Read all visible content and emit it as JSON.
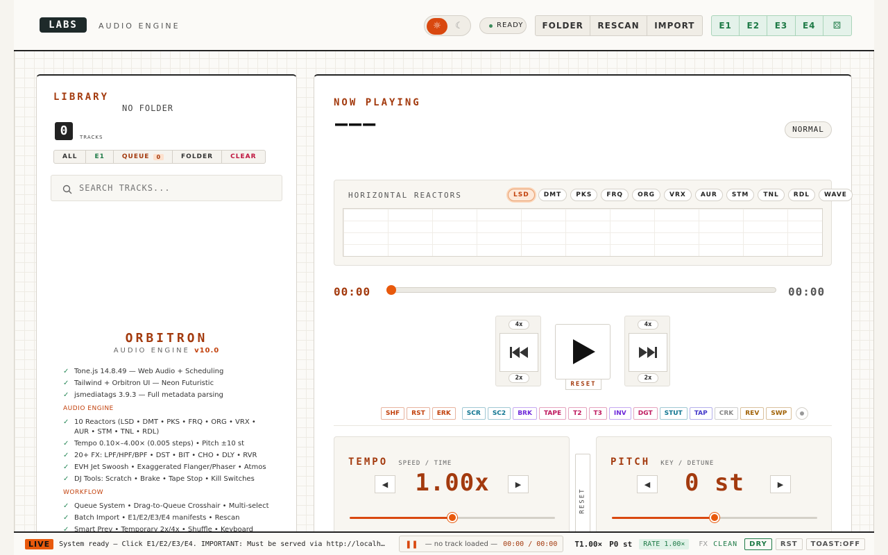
{
  "header": {
    "logo": "LABS",
    "subtitle": "AUDIO ENGINE",
    "status": "READY",
    "actions": [
      "FOLDER",
      "RESCAN",
      "IMPORT"
    ],
    "engines": [
      "E1",
      "E2",
      "E3",
      "E4"
    ]
  },
  "library": {
    "title": "LIBRARY",
    "folder": "NO FOLDER",
    "track_count": "0",
    "tracks_label": "TRACKS",
    "filters": {
      "all": "ALL",
      "e1": "E1",
      "queue": "QUEUE",
      "queue_count": "0",
      "folder": "FOLDER",
      "clear": "CLEAR"
    },
    "search_placeholder": "SEARCH TRACKS...",
    "about": {
      "name": "ORBITRON",
      "subtitle": "AUDIO ENGINE",
      "version": "v10.0",
      "stack": [
        "Tone.js 14.8.49 — Web Audio + Scheduling",
        "Tailwind + Orbitron UI — Neon Futuristic",
        "jsmediatags 3.9.3 — Full metadata parsing"
      ],
      "audio_header": "AUDIO ENGINE",
      "audio": [
        "10 Reactors (LSD • DMT • PKS • FRQ • ORG • VRX • AUR • STM • TNL • RDL)",
        "Tempo 0.10×–4.00× (0.005 steps) • Pitch ±10 st",
        "20+ FX: LPF/HPF/BPF • DST • BIT • CHO • DLY • RVR",
        "EVH Jet Swoosh • Exaggerated Flanger/Phaser • Atmos",
        "DJ Tools: Scratch • Brake • Tape Stop • Kill Switches"
      ],
      "workflow_header": "WORKFLOW",
      "workflow": [
        "Queue System • Drag-to-Queue Crosshair • Multi-select",
        "Batch Import • E1/E2/E3/E4 manifests • Rescan",
        "Smart Prev • Temporary 2x/4x • Shuffle • Keyboard"
      ]
    }
  },
  "now_playing": {
    "title": "NOW PLAYING",
    "track": "———",
    "mode": "NORMAL",
    "reactors_label": "HORIZONTAL REACTORS",
    "reactors": [
      "LSD",
      "DMT",
      "PKS",
      "FRQ",
      "ORG",
      "VRX",
      "AUR",
      "STM",
      "TNL",
      "RDL",
      "WAVE"
    ],
    "time_current": "00:00",
    "time_total": "00:00",
    "progress": 0,
    "prev_4x": "4x",
    "prev_2x": "2x",
    "next_4x": "4x",
    "next_2x": "2x",
    "reset": "RESET",
    "fx": [
      {
        "label": "SHF",
        "color": "#c2410c"
      },
      {
        "label": "RST",
        "color": "#c2410c"
      },
      {
        "label": "ERK",
        "color": "#c2410c"
      },
      {
        "label": "SCR",
        "color": "#0e7490"
      },
      {
        "label": "SC2",
        "color": "#0e7490"
      },
      {
        "label": "BRK",
        "color": "#6d28d9"
      },
      {
        "label": "TAPE",
        "color": "#be185d"
      },
      {
        "label": "T2",
        "color": "#be185d"
      },
      {
        "label": "T3",
        "color": "#be185d"
      },
      {
        "label": "INV",
        "color": "#6d28d9"
      },
      {
        "label": "DGT",
        "color": "#be185d"
      },
      {
        "label": "STUT",
        "color": "#0e7490"
      },
      {
        "label": "TAP",
        "color": "#4338ca"
      },
      {
        "label": "CRK",
        "color": "#888888"
      },
      {
        "label": "REV",
        "color": "#a16207"
      },
      {
        "label": "SWP",
        "color": "#a16207"
      }
    ],
    "tempo": {
      "title": "TEMPO",
      "subtitle": "SPEED / TIME",
      "value": "1.00x",
      "level": 0.5
    },
    "pitch": {
      "title": "PITCH",
      "subtitle": "KEY / DETUNE",
      "value": "0 st",
      "level": 0.5
    },
    "center_reset": "RESET"
  },
  "footer": {
    "live": "LIVE",
    "message": "System ready — Click E1/E2/E3/E4. IMPORTANT: Must be served via http://localh…",
    "track": "— no track loaded —",
    "time": "00:00 / 00:00",
    "tempo": "T1.00×",
    "pitch": "P0 st",
    "rate": "RATE 1.00×",
    "fx_label": "FX",
    "fx_value": "CLEAN",
    "dry": "DRY",
    "rst": "RST",
    "toast": "TOAST:OFF"
  },
  "colors": {
    "accent": "#d9480f",
    "accent_dark": "#a33a0e",
    "engine_green": "#1e7a46"
  }
}
